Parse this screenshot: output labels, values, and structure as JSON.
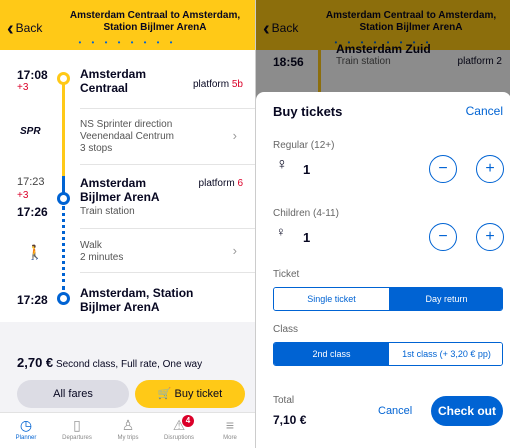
{
  "header": {
    "back_label": "Back",
    "title_line1": "Amsterdam Centraal to Amsterdam,",
    "title_line2": "Station Bijlmer ArenA",
    "dots": "• • • • • • • •"
  },
  "journey": {
    "departure": {
      "time": "17:08",
      "delay": "+3",
      "station_line1": "Amsterdam",
      "station_line2": "Centraal",
      "platform_label": "platform",
      "platform_num": "5b"
    },
    "train": {
      "type": "SPR",
      "line1": "NS Sprinter direction",
      "line2": "Veenendaal Centrum",
      "line3": "3 stops"
    },
    "transfer": {
      "arr_time": "17:23",
      "delay": "+3",
      "dep_time": "17:26",
      "station_line1": "Amsterdam",
      "station_line2": "Bijlmer ArenA",
      "kind": "Train station",
      "platform_label": "platform",
      "platform_num": "6"
    },
    "walk": {
      "label": "Walk",
      "duration": "2 minutes"
    },
    "arrival": {
      "time": "17:28",
      "station_line1": "Amsterdam, Station",
      "station_line2": "Bijlmer ArenA"
    }
  },
  "fare": {
    "price": "2,70 €",
    "description": "Second class, Full rate, One way"
  },
  "buttons": {
    "all_fares": "All fares",
    "buy_ticket": "Buy ticket"
  },
  "nav": {
    "items": [
      {
        "label": "Planner",
        "icon": "clock-icon"
      },
      {
        "label": "Departures",
        "icon": "train-icon"
      },
      {
        "label": "My trips",
        "icon": "person-star-icon"
      },
      {
        "label": "Disruptions",
        "icon": "warning-icon"
      },
      {
        "label": "More",
        "icon": "menu-icon"
      }
    ],
    "disruption_count": "4"
  },
  "background": {
    "time": "18:56",
    "station": "Amsterdam Zuid",
    "kind": "Train station",
    "platform": "platform 2"
  },
  "sheet": {
    "title": "Buy tickets",
    "cancel": "Cancel",
    "regular_label": "Regular (12+)",
    "regular_count": "1",
    "children_label": "Children (4-11)",
    "children_count": "1",
    "ticket_label": "Ticket",
    "ticket_options": [
      "Single ticket",
      "Day return"
    ],
    "class_label": "Class",
    "class_options": [
      "2nd class",
      "1st class (+ 3,20 € pp)"
    ],
    "total_label": "Total",
    "total": "7,10 €",
    "cancel_bottom": "Cancel",
    "checkout": "Check out"
  },
  "colors": {
    "ns_yellow": "#ffc917",
    "ns_blue": "#0063d3",
    "delay_red": "#db0029"
  }
}
